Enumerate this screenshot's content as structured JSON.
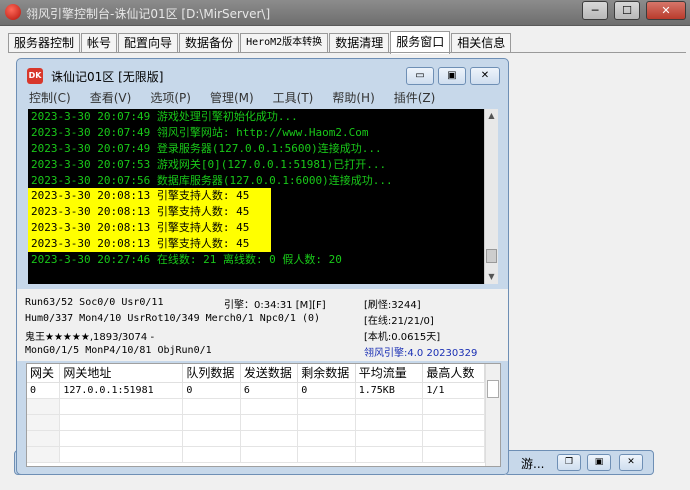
{
  "window": {
    "title": "翎风引擎控制台-诛仙记01区 [D:\\MirServer\\]",
    "min": "─",
    "max": "☐",
    "close": "✕"
  },
  "tabs": [
    {
      "label": "服务器控制"
    },
    {
      "label": "帐号"
    },
    {
      "label": "配置向导"
    },
    {
      "label": "数据备份"
    },
    {
      "label": "HeroM2版本转换"
    },
    {
      "label": "数据清理"
    },
    {
      "label": "服务窗口"
    },
    {
      "label": "相关信息"
    }
  ],
  "inner_window": {
    "icon_text": "DK",
    "title": "诛仙记01区 [无限版]",
    "min": "▭",
    "max": "▣",
    "close": "✕"
  },
  "menu": [
    {
      "label": "控制(C)"
    },
    {
      "label": "查看(V)"
    },
    {
      "label": "选项(P)"
    },
    {
      "label": "管理(M)"
    },
    {
      "label": "工具(T)"
    },
    {
      "label": "帮助(H)"
    },
    {
      "label": "插件(Z)"
    }
  ],
  "log": [
    "2023-3-30 20:07:49 游戏处理引擎初始化成功...",
    "2023-3-30 20:07:49 翎风引擎网站: http://www.Haom2.Com",
    "2023-3-30 20:07:49 登录服务器(127.0.0.1:5600)连接成功...",
    "2023-3-30 20:07:53 游戏网关[0](127.0.0.1:51981)已打开...",
    "2023-3-30 20:07:56 数据库服务器(127.0.0.1:6000)连接成功...",
    "2023-3-30 20:08:13 引擎支持人数: 45",
    "2023-3-30 20:08:13 引擎支持人数: 45",
    "2023-3-30 20:08:13 引擎支持人数: 45",
    "2023-3-30 20:08:13 引擎支持人数: 45",
    "2023-3-30 20:27:46 在线数: 21 离线数: 0 假人数: 20"
  ],
  "status": {
    "run": "Run63/52 Soc0/0 Usr0/11",
    "engine_time": "引擎：0:34:31 [M][F]",
    "refresh": "[刷怪:3244]",
    "hum": "Hum0/337 Mon4/10 UsrRot10/349 Merch0/1 Npc0/1 (0)",
    "online": "[在线:21/21/0]",
    "boss": "鬼王★★★★★,1893/3074 -",
    "local": "[本机:0.0615天]",
    "mongen": "MonG0/1/5 MonP4/10/81 ObjRun0/1",
    "version": "翎风引擎:4.0 20230329"
  },
  "gateway_table": {
    "columns": [
      "网关",
      "网关地址",
      "队列数据",
      "发送数据",
      "剩余数据",
      "平均流量",
      "最高人数"
    ],
    "rows": [
      [
        "0",
        "127.0.0.1:51981",
        "0",
        "6",
        "0",
        "1.75KB",
        "1/1"
      ]
    ]
  },
  "minimized": [
    {
      "label": "游..."
    }
  ],
  "colors": {
    "console_bg": "#000000",
    "console_text": "#19c819",
    "highlight": "#ffff00",
    "version_text": "#1a2fb4"
  }
}
